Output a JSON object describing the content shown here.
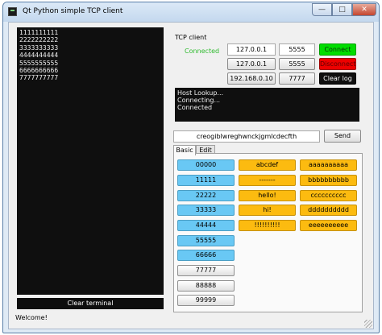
{
  "window": {
    "title": "Qt Python simple TCP client"
  },
  "terminal": {
    "lines": "1111111111\n2222222222\n3333333333\n4444444444\n5555555555\n6666666666\n7777777777",
    "clear_label": "Clear terminal"
  },
  "status_bar": {
    "text": "Welcome!"
  },
  "tcp": {
    "group_label": "TCP client",
    "status": "Connected",
    "hosts": [
      {
        "host": "127.0.0.1",
        "port": "5555"
      },
      {
        "host": "127.0.0.1",
        "port": "5555"
      },
      {
        "host": "192.168.0.10",
        "port": "7777"
      }
    ],
    "connect_label": "Connect",
    "disconnect_label": "Disconnect",
    "clearlog_label": "Clear log",
    "log": [
      "Host Lookup...",
      "Connecting...",
      "Connected"
    ]
  },
  "send": {
    "value": "creogiblwreghwnckjgmlcdecfth",
    "button_label": "Send"
  },
  "tabs": [
    {
      "label": "Basic"
    },
    {
      "label": "Edit"
    }
  ],
  "grid": {
    "col1": [
      "00000",
      "11111",
      "22222",
      "33333",
      "44444",
      "55555",
      "66666",
      "77777",
      "88888",
      "99999"
    ],
    "col2": [
      "abcdef",
      "-------",
      "hello!",
      "hi!",
      "!!!!!!!!!!"
    ],
    "col3": [
      "aaaaaaaaaa",
      "bbbbbbbbbb",
      "cccccccccc",
      "dddddddddd",
      "eeeeeeeeee"
    ]
  },
  "colors": {
    "connect_bg": "#00dd00",
    "disconnect_bg": "#ee0000",
    "connected_text": "#2ebb2e",
    "button_blue": "#69c8f4",
    "button_orange": "#fcbb10"
  }
}
